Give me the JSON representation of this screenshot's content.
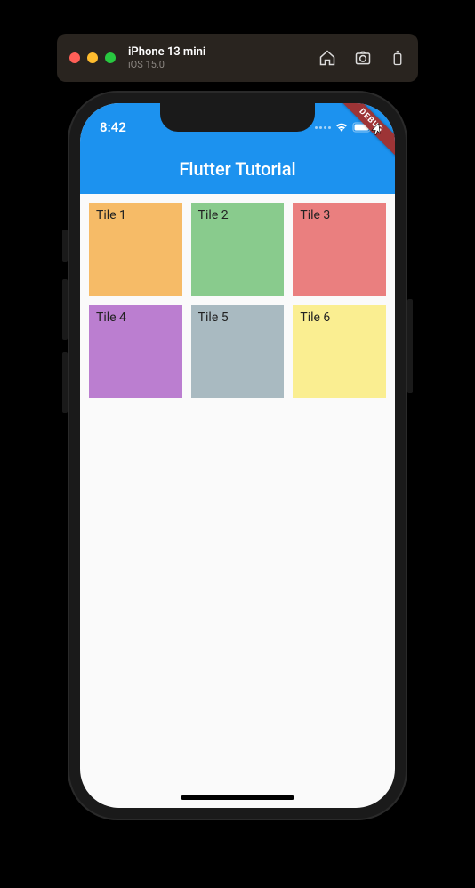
{
  "toolbar": {
    "device_name": "iPhone 13 mini",
    "device_os": "iOS 15.0"
  },
  "status": {
    "time": "8:42"
  },
  "app_bar": {
    "title": "Flutter Tutorial"
  },
  "debug_banner": {
    "label": "DEBUG"
  },
  "tiles": [
    {
      "label": "Tile 1",
      "color": "#f6bb67"
    },
    {
      "label": "Tile 2",
      "color": "#89cb8d"
    },
    {
      "label": "Tile 3",
      "color": "#ea7f7f"
    },
    {
      "label": "Tile 4",
      "color": "#bb7ed0"
    },
    {
      "label": "Tile 5",
      "color": "#a9bac1"
    },
    {
      "label": "Tile 6",
      "color": "#faee91"
    }
  ]
}
